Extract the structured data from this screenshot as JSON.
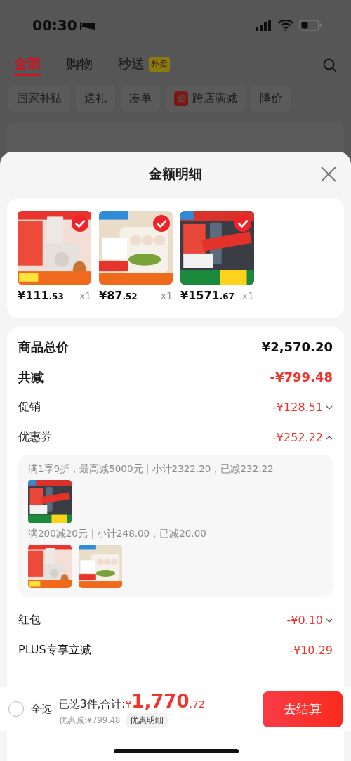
{
  "status_bar": {
    "time": "00:30"
  },
  "tabs": [
    {
      "label": "全部",
      "selected": true
    },
    {
      "label": "购物",
      "selected": false
    },
    {
      "label": "秒送",
      "badge": "外卖",
      "selected": false
    }
  ],
  "chips": [
    {
      "label": "国家补贴"
    },
    {
      "label": "送礼"
    },
    {
      "label": "凑单"
    },
    {
      "label": "跨店满减",
      "badge": "促"
    },
    {
      "label": "降价"
    }
  ],
  "sheet": {
    "title": "金额明细",
    "products": [
      {
        "kind": "picture",
        "price": "¥111",
        "price_cents": ".53",
        "qty": "x1",
        "selected": true
      },
      {
        "kind": "picture",
        "price": "¥87",
        "price_cents": ".52",
        "qty": "x1",
        "selected": true
      },
      {
        "kind": "picture",
        "price": "¥1571",
        "price_cents": ".67",
        "qty": "x1",
        "selected": true
      }
    ],
    "rows": [
      {
        "kind": "total",
        "label": "商品总价",
        "value": "¥2,570.20"
      },
      {
        "kind": "discount_total",
        "label": "共减",
        "value": "-¥799.48"
      },
      {
        "kind": "item",
        "label": "促销",
        "value": "-¥128.51",
        "expanded": false
      },
      {
        "kind": "item",
        "label": "优惠券",
        "value": "-¥252.22",
        "expanded": true,
        "groups": [
          {
            "rule": "满1享9折，最高减5000元",
            "subtotal": "小计2322.20，已减232.22"
          },
          {
            "rule": "满200减20元",
            "subtotal": "小计248.00，已减20.00"
          }
        ]
      },
      {
        "kind": "item",
        "label": "红包",
        "value": "-¥0.10",
        "expanded": false
      },
      {
        "kind": "plain",
        "label": "PLUS专享立减",
        "value": "-¥10.29"
      }
    ]
  },
  "footer": {
    "select_all": {
      "label": "全选",
      "checked": false
    },
    "summary": "已选3件,合计:",
    "currency": "¥",
    "total": "1,770",
    "total_cents": ".72",
    "discount": "优惠减:¥799.48",
    "detail_button": "优惠明细",
    "checkout": "去结算"
  }
}
